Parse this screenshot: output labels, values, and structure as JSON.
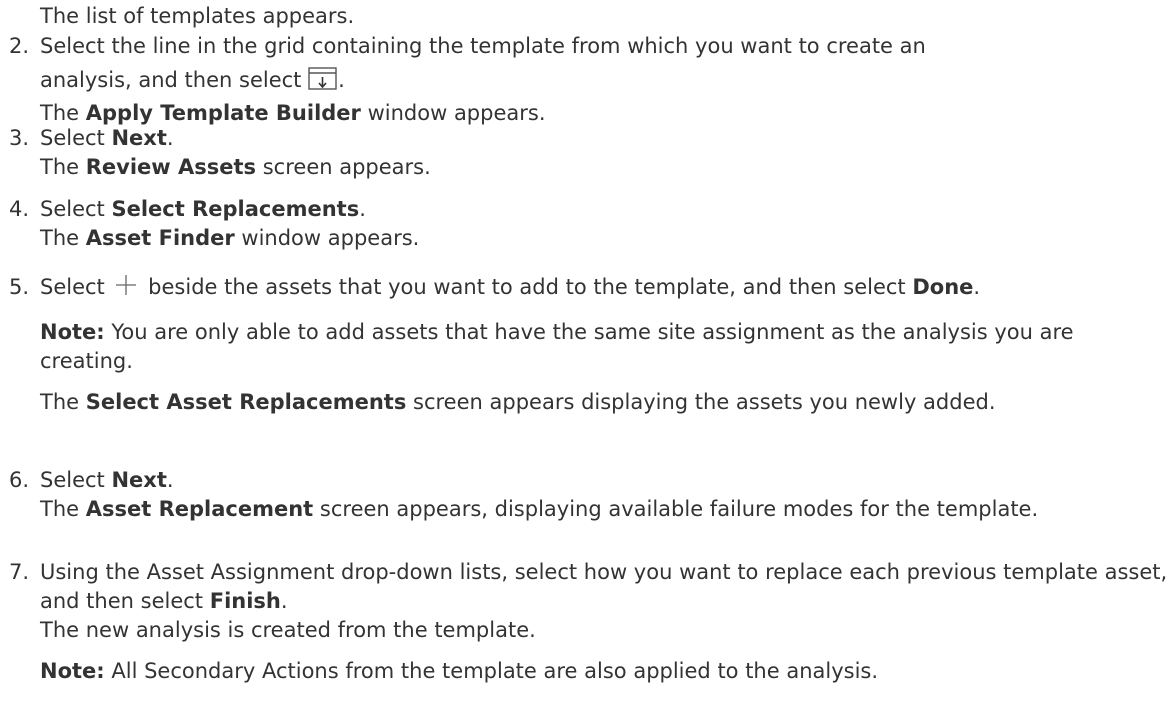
{
  "intro": "The list of templates appears.",
  "steps": [
    {
      "number": "2.",
      "line1": "Select the line in the grid containing the template from which you want to create an",
      "line2_pre": "analysis, and then select",
      "line2_post": ".",
      "icon": "apply-template-icon",
      "result_pre": "The",
      "result_bold": "Apply Template Builder",
      "result_post": "window appears."
    },
    {
      "number": "3.",
      "action_pre": "Select",
      "action_bold": "Next",
      "action_post": ".",
      "result_pre": "The",
      "result_bold": "Review Assets",
      "result_post": "screen appears."
    },
    {
      "number": "4.",
      "action_pre": "Select",
      "action_bold": "Select Replacements",
      "action_post": ".",
      "result_pre": "The",
      "result_bold": "Asset Finder",
      "result_post": "window appears."
    },
    {
      "number": "5.",
      "action_pre": "Select",
      "icon": "plus-icon",
      "action_mid": "beside the assets that you want to add to the template, and then select",
      "action_bold": "Done",
      "action_post": ".",
      "note_label": "Note:",
      "note_text": "You are only able to add assets that have the same site assignment as the analysis you are creating.",
      "result_pre": "The",
      "result_bold": "Select Asset Replacements",
      "result_post": "screen appears displaying the assets you newly added."
    },
    {
      "number": "6.",
      "action_pre": "Select",
      "action_bold": "Next",
      "action_post": ".",
      "result_pre": "The",
      "result_bold": "Asset Replacement",
      "result_post": "screen appears, displaying available failure modes for the template."
    },
    {
      "number": "7.",
      "action_text": "Using the Asset Assignment drop-down lists, select how you want to replace each previous template asset, and then select",
      "action_bold": "Finish",
      "action_post": ".",
      "result_text": "The new analysis is created from the template.",
      "note_label": "Note:",
      "note_text": "All Secondary Actions from the template are also applied to the analysis."
    }
  ]
}
